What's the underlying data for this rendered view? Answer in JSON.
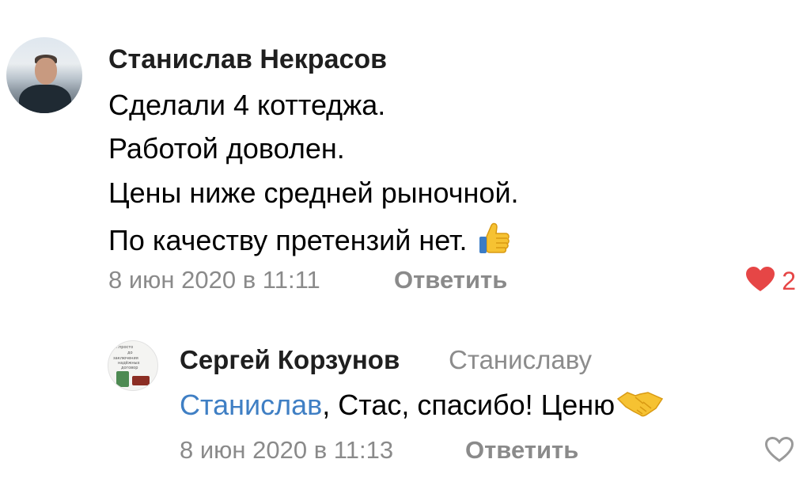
{
  "comments": [
    {
      "author": "Станислав Некрасов",
      "lines": [
        "Сделали 4 коттеджа.",
        "Работой доволен.",
        "Цены ниже средней рыночной.",
        "По качеству претензий нет."
      ],
      "line_emoji": "thumbs-up-icon",
      "timestamp": "8 июн 2020 в 11:11",
      "reply_label": "Ответить",
      "like_count": "2",
      "liked": true
    },
    {
      "author": "Сергей Корзунов",
      "reply_to": "Станиславу",
      "mention": "Станислав",
      "text": ", Стас, спасибо! Ценю",
      "text_emoji": "handshake-icon",
      "avatar_text": [
        "…просто",
        "до",
        "заключения",
        "надёжных",
        "договор"
      ],
      "timestamp": "8 июн 2020 в 11:13",
      "reply_label": "Ответить",
      "liked": false
    }
  ],
  "colors": {
    "mention": "#3f7fc4",
    "meta": "#8a8a8a",
    "like_active": "#e64646"
  }
}
